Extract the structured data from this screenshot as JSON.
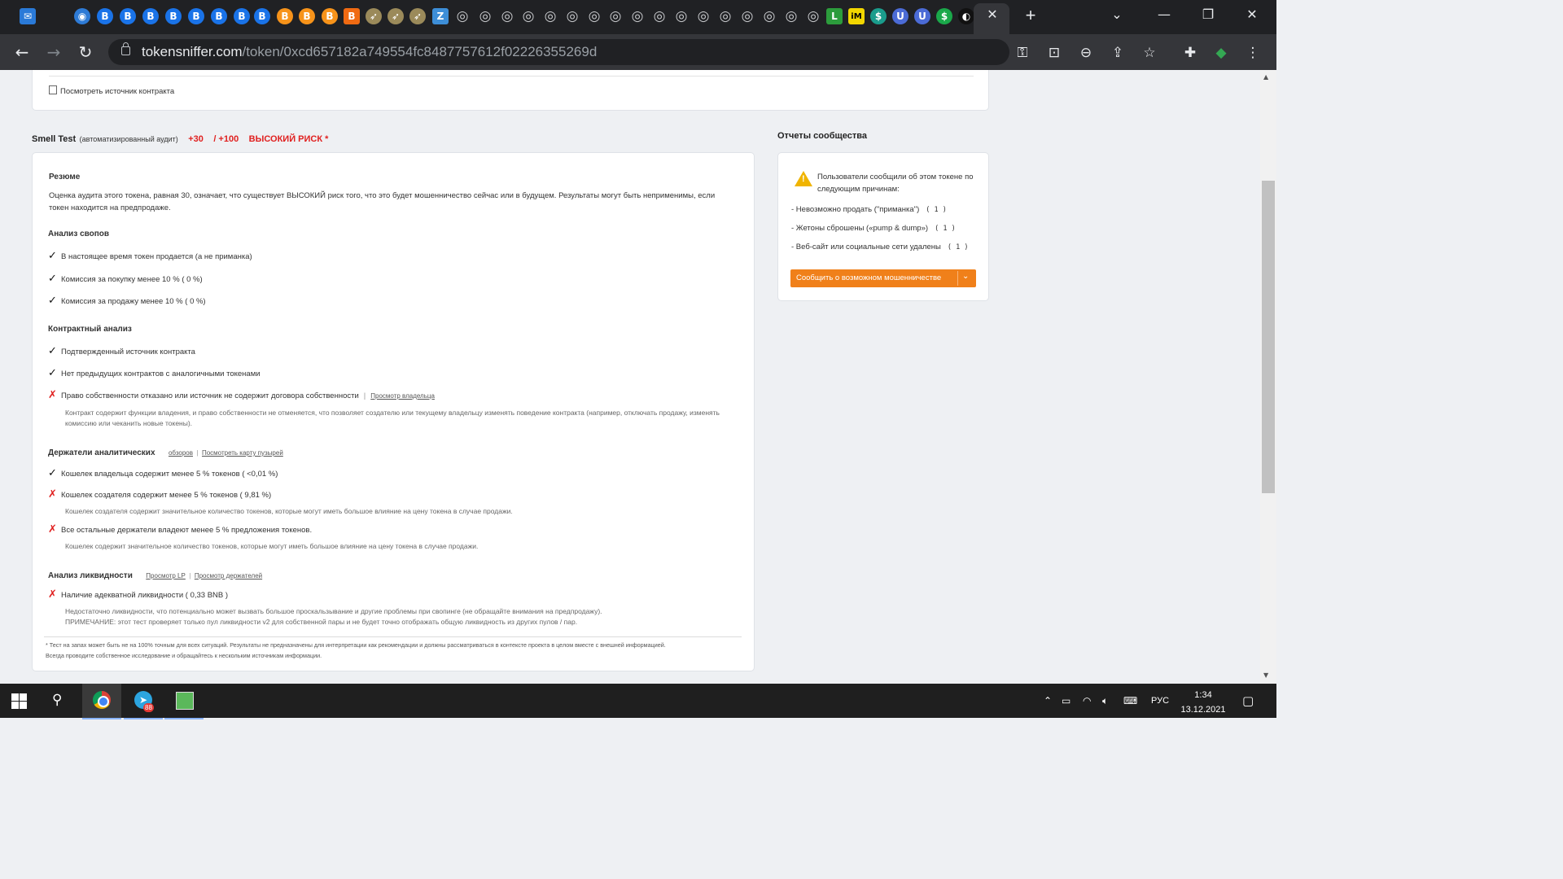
{
  "browser": {
    "url_host": "tokensniffer.com",
    "url_path": "/token/0xcd657182a749554fc8487757612f02226355269d",
    "tab_favicons": [
      {
        "icon": "mail-icon",
        "color": "#2a7ad8",
        "glyph": "✉"
      },
      {
        "icon": "owl-icon",
        "color": "#2e7bd6",
        "glyph": "◉"
      },
      {
        "icon": "bitcoin-blue-icon",
        "color": "#1a73e8",
        "glyph": "B"
      },
      {
        "icon": "bitcoin-blue-icon",
        "color": "#1a73e8",
        "glyph": "B"
      },
      {
        "icon": "bitcoin-blue-icon",
        "color": "#1a73e8",
        "glyph": "B"
      },
      {
        "icon": "bitcoin-blue-icon",
        "color": "#1a73e8",
        "glyph": "B"
      },
      {
        "icon": "bitcoin-blue-icon",
        "color": "#1a73e8",
        "glyph": "B"
      },
      {
        "icon": "bitcoin-blue-icon",
        "color": "#1a73e8",
        "glyph": "B"
      },
      {
        "icon": "bitcoin-blue-icon",
        "color": "#1a73e8",
        "glyph": "B"
      },
      {
        "icon": "bitcoin-blue-icon",
        "color": "#1a73e8",
        "glyph": "B"
      },
      {
        "icon": "shield-bitcoin-icon",
        "color": "#f7931a",
        "glyph": "B"
      },
      {
        "icon": "shield-bitcoin-icon",
        "color": "#f7931a",
        "glyph": "B"
      },
      {
        "icon": "bitcoin-orange-icon",
        "color": "#f7931a",
        "glyph": "B"
      },
      {
        "icon": "bitcoin-square-icon",
        "color": "#f06a12",
        "glyph": "B"
      },
      {
        "icon": "bird-icon",
        "color": "#9b8a5a",
        "glyph": "➶"
      },
      {
        "icon": "bird-icon",
        "color": "#9b8a5a",
        "glyph": "➶"
      },
      {
        "icon": "bird-icon",
        "color": "#9b8a5a",
        "glyph": "➶"
      },
      {
        "icon": "z-icon",
        "color": "#3d8ed8",
        "glyph": "Z"
      },
      {
        "icon": "globe-icon",
        "color": "#8a8d91",
        "glyph": "◎"
      },
      {
        "icon": "globe-icon",
        "color": "#8a8d91",
        "glyph": "◎"
      },
      {
        "icon": "globe-icon",
        "color": "#8a8d91",
        "glyph": "◎"
      },
      {
        "icon": "globe-icon",
        "color": "#8a8d91",
        "glyph": "◎"
      },
      {
        "icon": "globe-icon",
        "color": "#8a8d91",
        "glyph": "◎"
      },
      {
        "icon": "globe-icon",
        "color": "#8a8d91",
        "glyph": "◎"
      },
      {
        "icon": "globe-icon",
        "color": "#8a8d91",
        "glyph": "◎"
      },
      {
        "icon": "globe-icon",
        "color": "#8a8d91",
        "glyph": "◎"
      },
      {
        "icon": "globe-icon",
        "color": "#8a8d91",
        "glyph": "◎"
      },
      {
        "icon": "globe-icon",
        "color": "#8a8d91",
        "glyph": "◎"
      },
      {
        "icon": "globe-icon",
        "color": "#8a8d91",
        "glyph": "◎"
      },
      {
        "icon": "globe-icon",
        "color": "#8a8d91",
        "glyph": "◎"
      },
      {
        "icon": "globe-icon",
        "color": "#8a8d91",
        "glyph": "◎"
      },
      {
        "icon": "globe-icon",
        "color": "#8a8d91",
        "glyph": "◎"
      },
      {
        "icon": "globe-icon",
        "color": "#8a8d91",
        "glyph": "◎"
      },
      {
        "icon": "globe-icon",
        "color": "#8a8d91",
        "glyph": "◎"
      },
      {
        "icon": "globe-icon",
        "color": "#8a8d91",
        "glyph": "◎"
      },
      {
        "icon": "l-green-icon",
        "color": "#2c9c3c",
        "glyph": "L"
      },
      {
        "icon": "im-yellow-icon",
        "color": "#f2d600",
        "glyph": "iM"
      },
      {
        "icon": "dollar-teal-icon",
        "color": "#1a9c8c",
        "glyph": "$"
      },
      {
        "icon": "shield-u-icon",
        "color": "#4b6bd6",
        "glyph": "U"
      },
      {
        "icon": "shield-u-icon",
        "color": "#4b6bd6",
        "glyph": "U"
      },
      {
        "icon": "dollar-green-icon",
        "color": "#1aa84a",
        "glyph": "$"
      },
      {
        "icon": "dark-circle-icon",
        "color": "#111111",
        "glyph": "◐"
      }
    ]
  },
  "top_card": {
    "view_source_link": "Посмотреть источник контракта"
  },
  "smell": {
    "title": "Smell Test",
    "subtitle": "(автоматизированный аудит)",
    "score": "+30",
    "max": "/ +100",
    "risk": "ВЫСОКИЙ РИСК *"
  },
  "summary": {
    "heading": "Резюме",
    "text": "Оценка аудита этого токена, равная 30, означает, что существует ВЫСОКИЙ риск того, что это будет мошенничество сейчас или в будущем. Результаты могут быть неприменимы, если токен находится на предпродаже."
  },
  "swap": {
    "heading": "Анализ свопов",
    "items": [
      "В настоящее время токен продается (а не приманка)",
      "Комиссия за покупку менее 10 % ( 0 %)",
      "Комиссия за продажу менее 10 % ( 0 %)"
    ]
  },
  "contract": {
    "heading": "Контрактный анализ",
    "item1": "Подтвержденный источник контракта",
    "item2": "Нет предыдущих контрактов с аналогичными токенами",
    "item3": "Право собственности отказано или источник не содержит договора собственности",
    "owner_link": "Просмотр владельца",
    "note": "Контракт содержит функции владения, и право собственности не отменяется, что позволяет создателю или текущему владельцу изменять поведение контракта (например, отключать продажу, изменять комиссию или чеканить новые токены)."
  },
  "holders": {
    "heading": "Держатели аналитических",
    "link1": "обзоров",
    "link2": "Посмотреть карту пузырей",
    "item1": "Кошелек владельца содержит менее 5 % токенов ( <0,01 %)",
    "item2": "Кошелек создателя содержит менее 5 % токенов ( 9,81 %)",
    "note2": "Кошелек создателя содержит значительное количество токенов, которые могут иметь большое влияние на цену токена в случае продажи.",
    "item3": "Все остальные держатели владеют менее 5 % предложения токенов.",
    "note3": "Кошелек содержит значительное количество токенов, которые могут иметь большое влияние на цену токена в случае продажи."
  },
  "liquidity": {
    "heading": "Анализ ликвидности",
    "link1": "Просмотр LP",
    "link2": "Просмотр держателей",
    "item1": "Наличие адекватной ликвидности ( 0,33  BNB )",
    "note1": "Недостаточно ликвидности, что потенциально может вызвать большое проскальзывание и другие проблемы при свопинге (не обращайте внимания на предпродажу).",
    "note2": "ПРИМЕЧАНИЕ: этот тест проверяет только пул ликвидности v2 для собственной пары и не будет точно отображать общую ликвидность из других пулов / пар."
  },
  "footnote": {
    "line1": "* Тест на запах может быть не на 100% точным для всех ситуаций. Результаты не предназначены для интерпретации как рекомендации и должны рассматриваться в контексте проекта в целом вместе с внешней информацией.",
    "line2": "Всегда проводите собственное исследование и обращайтесь к нескольким источникам информации."
  },
  "community": {
    "heading": "Отчеты сообщества",
    "intro": "Пользователи сообщили об этом токене по следующим причинам:",
    "reasons": [
      {
        "text": "- Невозможно продать (\"приманка\")",
        "count": "( 1 )"
      },
      {
        "text": "- Жетоны сброшены («pump & dump»)",
        "count": "( 1 )"
      },
      {
        "text": "- Веб-сайт или социальные сети удалены",
        "count": "( 1 )"
      }
    ],
    "report_button": "Сообщить о возможном мошенничестве"
  },
  "taskbar": {
    "lang": "РУС",
    "time": "1:34",
    "date": "13.12.2021",
    "telegram_badge": "88"
  }
}
